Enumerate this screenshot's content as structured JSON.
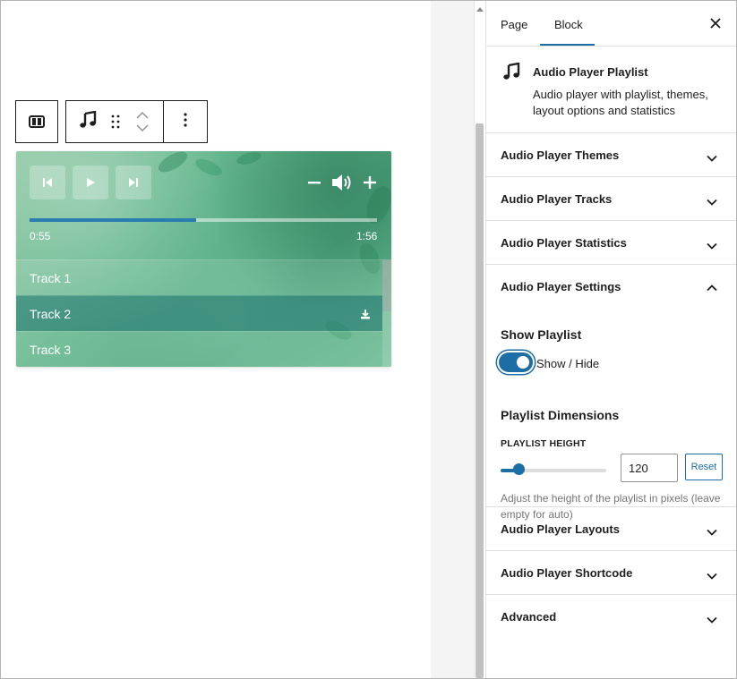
{
  "player": {
    "time_current": "0:55",
    "time_total": "1:56",
    "progress_percent": 48,
    "tracks": [
      {
        "label": "Track 1",
        "active": false
      },
      {
        "label": "Track 2",
        "active": true
      },
      {
        "label": "Track 3",
        "active": false
      }
    ]
  },
  "sidebar": {
    "tabs": [
      {
        "label": "Page",
        "selected": false
      },
      {
        "label": "Block",
        "selected": true
      }
    ],
    "block": {
      "name": "Audio Player Playlist",
      "description": "Audio player with playlist, themes, layout options and statistics"
    },
    "panels_top": [
      {
        "title": "Audio Player Themes"
      },
      {
        "title": "Audio Player Tracks"
      },
      {
        "title": "Audio Player Statistics"
      }
    ],
    "settings": {
      "title": "Audio Player Settings",
      "show_playlist_heading": "Show Playlist",
      "toggle_label": "Show / Hide",
      "toggle_on": true,
      "dimensions_heading": "Playlist Dimensions",
      "height_label": "PLAYLIST HEIGHT",
      "height_value": "120",
      "reset_label": "Reset",
      "help_text": "Adjust the height of the playlist in pixels (leave empty for auto)"
    },
    "panels_bottom": [
      {
        "title": "Audio Player Layouts"
      },
      {
        "title": "Audio Player Shortcode"
      },
      {
        "title": "Advanced"
      }
    ]
  },
  "colors": {
    "accent": "#1c6ea4",
    "player_green": "#62b58c",
    "text": "#1e1e1e",
    "muted": "#757575",
    "border": "#e0e0e0"
  }
}
